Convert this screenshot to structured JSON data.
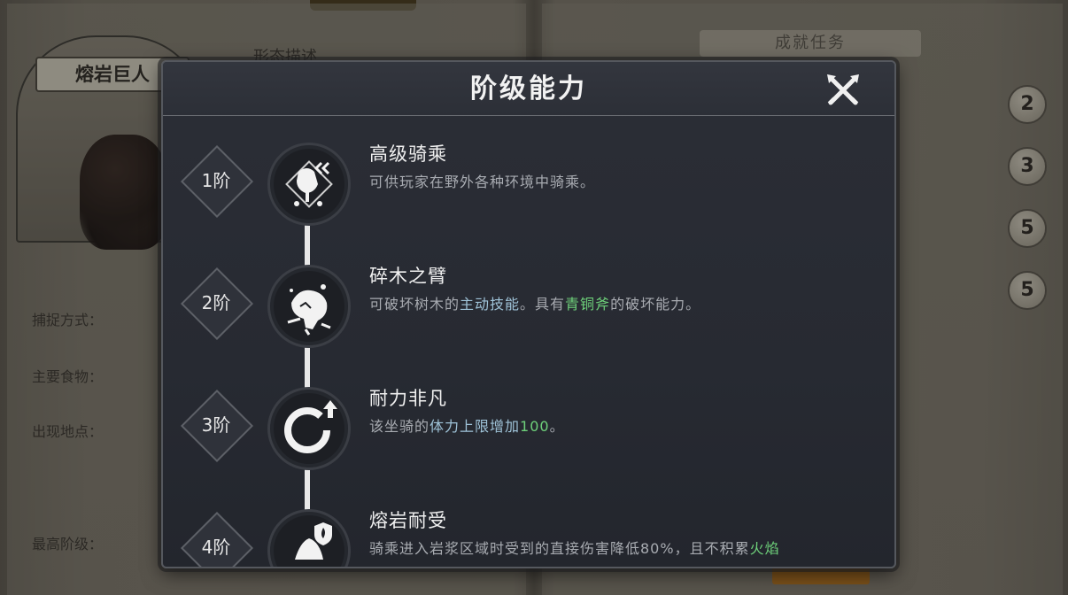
{
  "background": {
    "creature_name": "熔岩巨人",
    "form_section_title": "形态描述",
    "achievement_tab": "成就任务",
    "labels": [
      "捕捉方式：",
      "主要食物：",
      "出现地点：",
      "最高阶级："
    ],
    "achievement_counts": [
      "2",
      "3",
      "5",
      "5"
    ]
  },
  "modal": {
    "title": "阶级能力",
    "close_icon": "close-crossed-swords-icon",
    "tiers": [
      {
        "tier_label": "1阶",
        "icon": "riding-saddle-icon",
        "name": "高级骑乘",
        "desc": "可供玩家在野外各种环境中骑乘。"
      },
      {
        "tier_label": "2阶",
        "icon": "wood-smash-fist-icon",
        "name": "碎木之臂",
        "desc_parts": [
          "可破坏树木的",
          "主动技能",
          "。具有",
          "青铜斧",
          "的破坏能力。"
        ]
      },
      {
        "tier_label": "3阶",
        "icon": "stamina-ring-up-icon",
        "name": "耐力非凡",
        "desc_parts": [
          "该坐骑的",
          "体力上限增加",
          "100",
          "。"
        ]
      },
      {
        "tier_label": "4阶",
        "icon": "lava-fire-shield-icon",
        "name": "熔岩耐受",
        "desc_parts": [
          "骑乘进入岩浆区域时受到的直接伤害降低80%，且不积累",
          "火焰"
        ]
      }
    ]
  }
}
